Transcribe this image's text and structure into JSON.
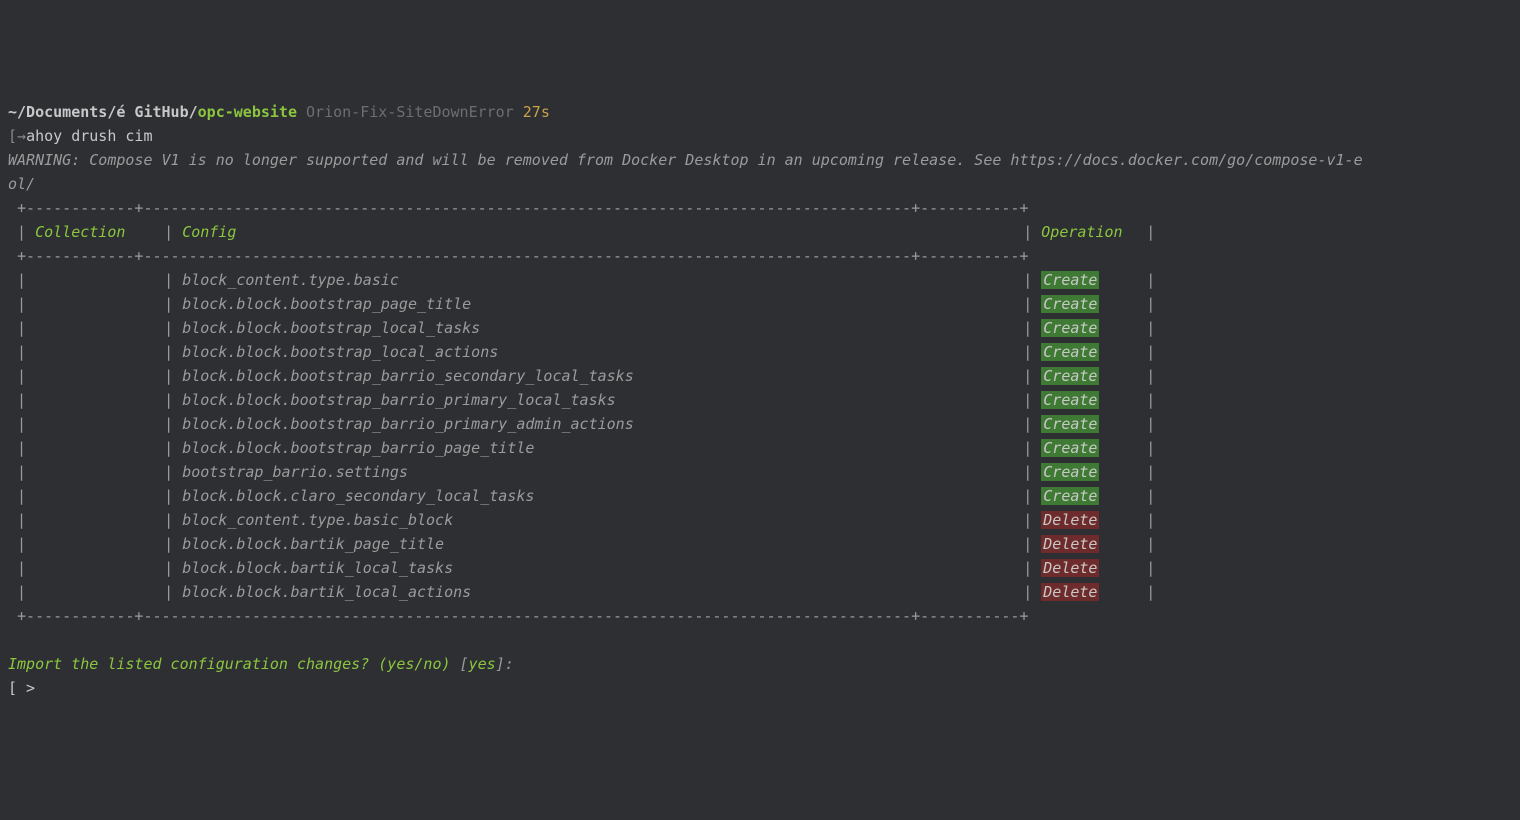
{
  "prompt": {
    "path_prefix": "~/Documents/é GitHub/",
    "repo": "opc-website",
    "branch": "Orion-Fix-SiteDownError",
    "duration": "27s",
    "bracket_open": "[→",
    "command": "ahoy drush cim"
  },
  "warning": "WARNING: Compose V1 is no longer supported and will be removed from Docker Desktop in an upcoming release. See https://docs.docker.com/go/compose-v1-e\nol/",
  "table": {
    "headers": {
      "collection": "Collection",
      "config": "Config",
      "operation": "Operation"
    },
    "rows": [
      {
        "collection": "",
        "config": "block_content.type.basic",
        "op": "Create"
      },
      {
        "collection": "",
        "config": "block.block.bootstrap_page_title",
        "op": "Create"
      },
      {
        "collection": "",
        "config": "block.block.bootstrap_local_tasks",
        "op": "Create"
      },
      {
        "collection": "",
        "config": "block.block.bootstrap_local_actions",
        "op": "Create"
      },
      {
        "collection": "",
        "config": "block.block.bootstrap_barrio_secondary_local_tasks",
        "op": "Create"
      },
      {
        "collection": "",
        "config": "block.block.bootstrap_barrio_primary_local_tasks",
        "op": "Create"
      },
      {
        "collection": "",
        "config": "block.block.bootstrap_barrio_primary_admin_actions",
        "op": "Create"
      },
      {
        "collection": "",
        "config": "block.block.bootstrap_barrio_page_title",
        "op": "Create"
      },
      {
        "collection": "",
        "config": "bootstrap_barrio.settings",
        "op": "Create"
      },
      {
        "collection": "",
        "config": "block.block.claro_secondary_local_tasks",
        "op": "Create"
      },
      {
        "collection": "",
        "config": "block_content.type.basic_block",
        "op": "Delete"
      },
      {
        "collection": "",
        "config": "block.block.bartik_page_title",
        "op": "Delete"
      },
      {
        "collection": "",
        "config": "block.block.bartik_local_tasks",
        "op": "Delete"
      },
      {
        "collection": "",
        "config": "block.block.bartik_local_actions",
        "op": "Delete"
      }
    ]
  },
  "question": {
    "text": "Import the listed configuration changes? (yes/no)",
    "default_open": " [",
    "default_val": "yes",
    "default_close": "]:"
  },
  "caret": "[ >"
}
